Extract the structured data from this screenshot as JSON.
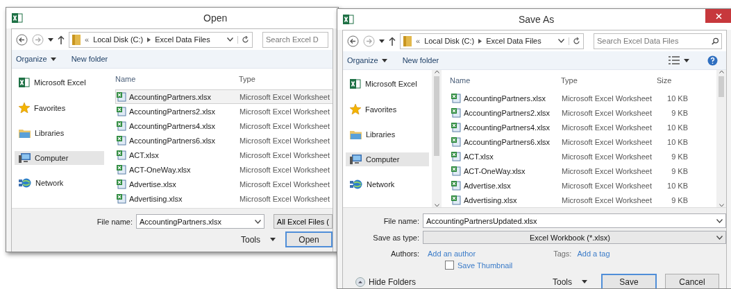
{
  "open_dialog": {
    "title": "Open",
    "path_prefix": "«",
    "path": [
      "Local Disk (C:)",
      "Excel Data Files"
    ],
    "search": {
      "placeholder": "Search Excel D"
    },
    "toolbar": [
      {
        "label": "Organize",
        "dropdown": true
      },
      {
        "label": "New folder",
        "dropdown": false
      }
    ],
    "sidebar": [
      {
        "kind": "excel",
        "label": "Microsoft Excel",
        "selected": false
      },
      {
        "kind": "star",
        "label": "Favorites",
        "selected": false
      },
      {
        "kind": "library",
        "label": "Libraries",
        "selected": false
      },
      {
        "kind": "computer",
        "label": "Computer",
        "selected": true
      },
      {
        "kind": "network",
        "label": "Network",
        "selected": false
      }
    ],
    "columns": [
      "Name",
      "Type"
    ],
    "rows": [
      {
        "name": "AccountingPartners.xlsx",
        "type": "Microsoft Excel Worksheet",
        "selected": true
      },
      {
        "name": "AccountingPartners2.xlsx",
        "type": "Microsoft Excel Worksheet",
        "selected": false
      },
      {
        "name": "AccountingPartners4.xlsx",
        "type": "Microsoft Excel Worksheet",
        "selected": false
      },
      {
        "name": "AccountingPartners6.xlsx",
        "type": "Microsoft Excel Worksheet",
        "selected": false
      },
      {
        "name": "ACT.xlsx",
        "type": "Microsoft Excel Worksheet",
        "selected": false
      },
      {
        "name": "ACT-OneWay.xlsx",
        "type": "Microsoft Excel Worksheet",
        "selected": false
      },
      {
        "name": "Advertise.xlsx",
        "type": "Microsoft Excel Worksheet",
        "selected": false
      },
      {
        "name": "Advertising.xlsx",
        "type": "Microsoft Excel Worksheet",
        "selected": false
      }
    ],
    "file_name_label": "File name:",
    "file_name": "AccountingPartners.xlsx",
    "file_type": "All Excel Files (",
    "tools": "Tools",
    "open_button": "Open"
  },
  "save_dialog": {
    "title": "Save As",
    "path_prefix": "«",
    "path": [
      "Local Disk (C:)",
      "Excel Data Files"
    ],
    "search": {
      "placeholder": "Search Excel Data Files"
    },
    "toolbar": [
      {
        "label": "Organize",
        "dropdown": true
      },
      {
        "label": "New folder",
        "dropdown": false
      }
    ],
    "sidebar": [
      {
        "kind": "excel",
        "label": "Microsoft Excel",
        "selected": false
      },
      {
        "kind": "star",
        "label": "Favorites",
        "selected": false
      },
      {
        "kind": "library",
        "label": "Libraries",
        "selected": false
      },
      {
        "kind": "computer",
        "label": "Computer",
        "selected": true
      },
      {
        "kind": "network",
        "label": "Network",
        "selected": false
      }
    ],
    "columns": [
      "Name",
      "Type",
      "Size"
    ],
    "rows": [
      {
        "name": "AccountingPartners.xlsx",
        "type": "Microsoft Excel Worksheet",
        "size": "10 KB",
        "selected": false
      },
      {
        "name": "AccountingPartners2.xlsx",
        "type": "Microsoft Excel Worksheet",
        "size": "9 KB",
        "selected": false
      },
      {
        "name": "AccountingPartners4.xlsx",
        "type": "Microsoft Excel Worksheet",
        "size": "10 KB",
        "selected": false
      },
      {
        "name": "AccountingPartners6.xlsx",
        "type": "Microsoft Excel Worksheet",
        "size": "10 KB",
        "selected": false
      },
      {
        "name": "ACT.xlsx",
        "type": "Microsoft Excel Worksheet",
        "size": "9 KB",
        "selected": false
      },
      {
        "name": "ACT-OneWay.xlsx",
        "type": "Microsoft Excel Worksheet",
        "size": "9 KB",
        "selected": false
      },
      {
        "name": "Advertise.xlsx",
        "type": "Microsoft Excel Worksheet",
        "size": "10 KB",
        "selected": false
      },
      {
        "name": "Advertising.xlsx",
        "type": "Microsoft Excel Worksheet",
        "size": "9 KB",
        "selected": false
      }
    ],
    "file_name_label": "File name:",
    "file_name": "AccountingPartnersUpdated.xlsx",
    "save_type_label": "Save as type:",
    "save_type": "Excel Workbook (*.xlsx)",
    "authors_label": "Authors:",
    "authors_value": "Add an author",
    "tags_label": "Tags:",
    "tags_value": "Add a tag",
    "thumbnail": {
      "label": "Save Thumbnail",
      "checked": false
    },
    "hide_folders": "Hide Folders",
    "tools": "Tools",
    "save_button": "Save",
    "cancel_button": "Cancel"
  }
}
